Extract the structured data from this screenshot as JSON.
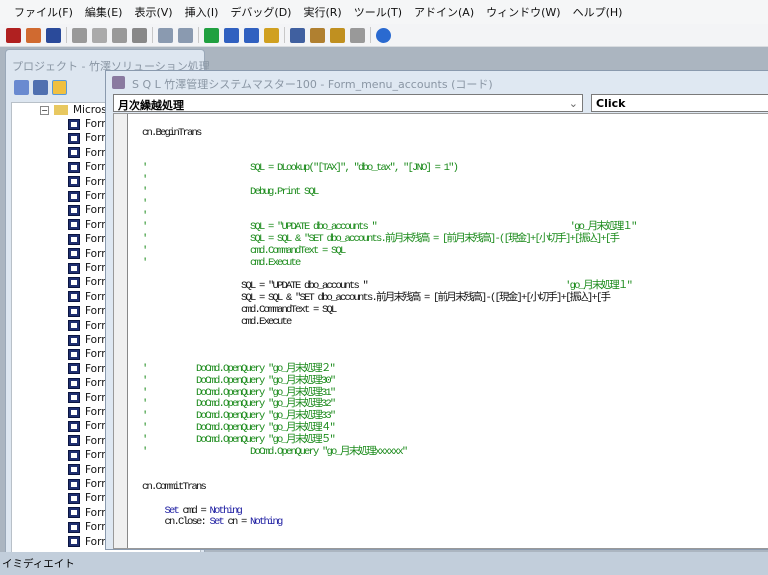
{
  "menu": [
    "ファイル(F)",
    "編集(E)",
    "表示(V)",
    "挿入(I)",
    "デバッグ(D)",
    "実行(R)",
    "ツール(T)",
    "アドイン(A)",
    "ウィンドウ(W)",
    "ヘルプ(H)"
  ],
  "toolbar": [
    "access-icon",
    "insert-icon",
    "save-icon",
    "cut-icon",
    "copy-icon",
    "paste-icon",
    "find-icon",
    "undo-icon",
    "redo-icon",
    "run-icon",
    "break-icon",
    "reset-icon",
    "design-icon",
    "project-explorer-icon",
    "properties-icon",
    "object-browser-icon",
    "toolbox-icon",
    "help-icon"
  ],
  "project": {
    "title": "プロジェクト - 竹澤ソリューション処理",
    "root": "Microsoft",
    "items": [
      "Form",
      "Form",
      "Form",
      "Form",
      "Form",
      "Form",
      "Form",
      "Form",
      "Form",
      "Form",
      "Form",
      "Form",
      "Form",
      "Form",
      "Form",
      "Form",
      "Form",
      "Form",
      "Form",
      "Form",
      "Form",
      "Form",
      "Form",
      "Form",
      "Form",
      "Form",
      "Form",
      "Form",
      "Form",
      "Form"
    ]
  },
  "code_window": {
    "title": "S Q L 竹澤管理システムマスター100 - Form_menu_accounts (コード)",
    "object_combo": "月次繰越処理",
    "proc_combo": "Click"
  },
  "code_lines": [
    [
      [
        "code",
        "cn.BeginTrans"
      ]
    ],
    [],
    [],
    [
      [
        "comment",
        "'                       SQL = DLookup(\"[TAX]\", \"dbo_tax\", \"[JNO] = 1\")"
      ]
    ],
    [
      [
        "comment",
        "'"
      ]
    ],
    [
      [
        "comment",
        "'                       Debug.Print SQL"
      ]
    ],
    [
      [
        "comment",
        "'"
      ]
    ],
    [
      [
        "comment",
        "'"
      ]
    ],
    [
      [
        "comment",
        "'                       SQL = \"UPDATE dbo_accounts \"                                           'go_月末処理１\""
      ]
    ],
    [
      [
        "comment",
        "'                       SQL = SQL & \"SET dbo_accounts.前月末残高 = [前月末残高]-([現金]+[小切手]+[振込]+[手"
      ]
    ],
    [
      [
        "comment",
        "'                       cmd.CommandText = SQL"
      ]
    ],
    [
      [
        "comment",
        "'                       cmd.Execute"
      ]
    ],
    [],
    [
      [
        "code",
        "                      SQL = \"UPDATE dbo_accounts \"                                            "
      ],
      [
        "comment",
        "'go_月末処理１\""
      ]
    ],
    [
      [
        "code",
        "                      SQL = SQL & \"SET dbo_accounts.前月末残高 = [前月末残高]-([現金]+[小切手]+[振込]+[手"
      ]
    ],
    [
      [
        "code",
        "                      cmd.CommandText = SQL"
      ]
    ],
    [
      [
        "code",
        "                      cmd.Execute"
      ]
    ],
    [],
    [],
    [],
    [
      [
        "comment",
        "'           DoCmd.OpenQuery \"go_月末処理２\""
      ]
    ],
    [
      [
        "comment",
        "'           DoCmd.OpenQuery \"go_月末処理30\""
      ]
    ],
    [
      [
        "comment",
        "'           DoCmd.OpenQuery \"go_月末処理31\""
      ]
    ],
    [
      [
        "comment",
        "'           DoCmd.OpenQuery \"go_月末処理32\""
      ]
    ],
    [
      [
        "comment",
        "'           DoCmd.OpenQuery \"go_月末処理33\""
      ]
    ],
    [
      [
        "comment",
        "'           DoCmd.OpenQuery \"go_月末処理４\""
      ]
    ],
    [
      [
        "comment",
        "'           DoCmd.OpenQuery \"go_月末処理５\""
      ]
    ],
    [
      [
        "comment",
        "'                       DoCmd.OpenQuery \"go_月末処理xxxxxx\""
      ]
    ],
    [],
    [],
    [
      [
        "code",
        "cn.CommitTrans"
      ]
    ],
    [],
    [
      [
        "kw",
        "     Set"
      ],
      [
        "code",
        " cmd = "
      ],
      [
        "kw",
        "Nothing"
      ]
    ],
    [
      [
        "code",
        "     cn.Close: "
      ],
      [
        "kw",
        "Set"
      ],
      [
        "code",
        " cn = "
      ],
      [
        "kw",
        "Nothing"
      ]
    ]
  ],
  "status": {
    "immediate": "イミディエイト"
  },
  "colors": {
    "comment": "#1a8a1a",
    "keyword": "#1a1aa0"
  }
}
